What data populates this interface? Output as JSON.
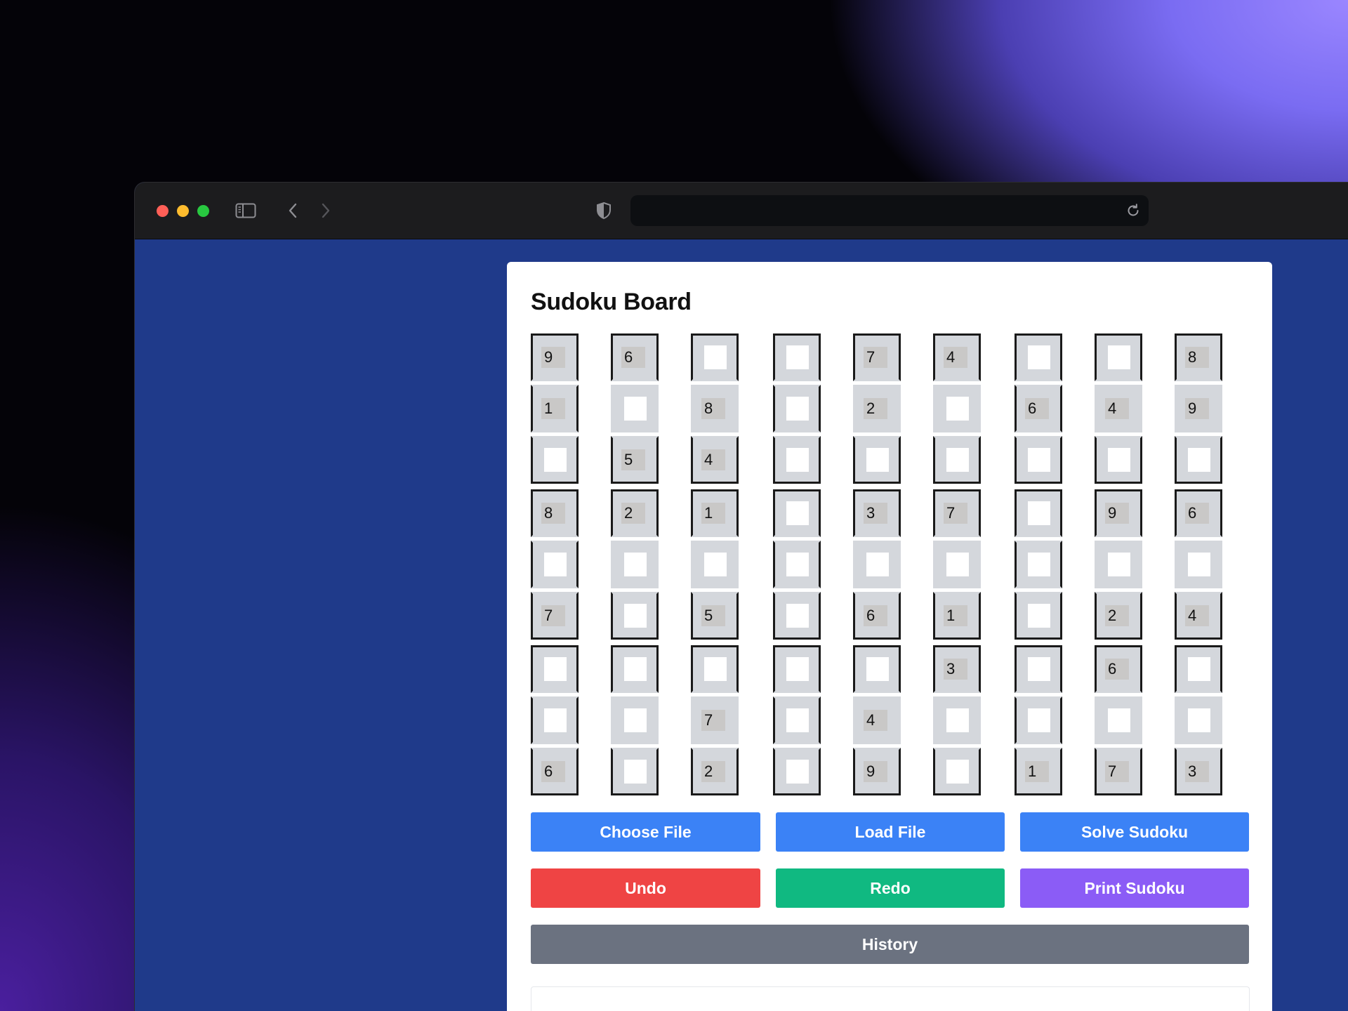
{
  "browser": {
    "url": ""
  },
  "page": {
    "title": "Sudoku Board"
  },
  "board": [
    [
      "9",
      "6",
      "",
      "",
      "7",
      "4",
      "",
      "",
      "8"
    ],
    [
      "1",
      "",
      "8",
      "",
      "2",
      "",
      "6",
      "4",
      "9"
    ],
    [
      "",
      "5",
      "4",
      "",
      "",
      "",
      "",
      "",
      ""
    ],
    [
      "8",
      "2",
      "1",
      "",
      "3",
      "7",
      "",
      "9",
      "6"
    ],
    [
      "",
      "",
      "",
      "",
      "",
      "",
      "",
      "",
      ""
    ],
    [
      "7",
      "",
      "5",
      "",
      "6",
      "1",
      "",
      "2",
      "4"
    ],
    [
      "",
      "",
      "",
      "",
      "",
      "3",
      "",
      "6",
      ""
    ],
    [
      "",
      "",
      "7",
      "",
      "4",
      "",
      "",
      "",
      ""
    ],
    [
      "6",
      "",
      "2",
      "",
      "9",
      "",
      "1",
      "7",
      "3"
    ]
  ],
  "buttons": {
    "choose_file": "Choose File",
    "load_file": "Load File",
    "solve": "Solve Sudoku",
    "undo": "Undo",
    "redo": "Redo",
    "print": "Print Sudoku",
    "history": "History"
  },
  "colors": {
    "page_background": "#1f3a8a",
    "primary_button": "#3b82f6",
    "undo_button": "#ef4444",
    "redo_button": "#10b981",
    "print_button": "#8b5cf6",
    "history_button": "#6b7280"
  }
}
